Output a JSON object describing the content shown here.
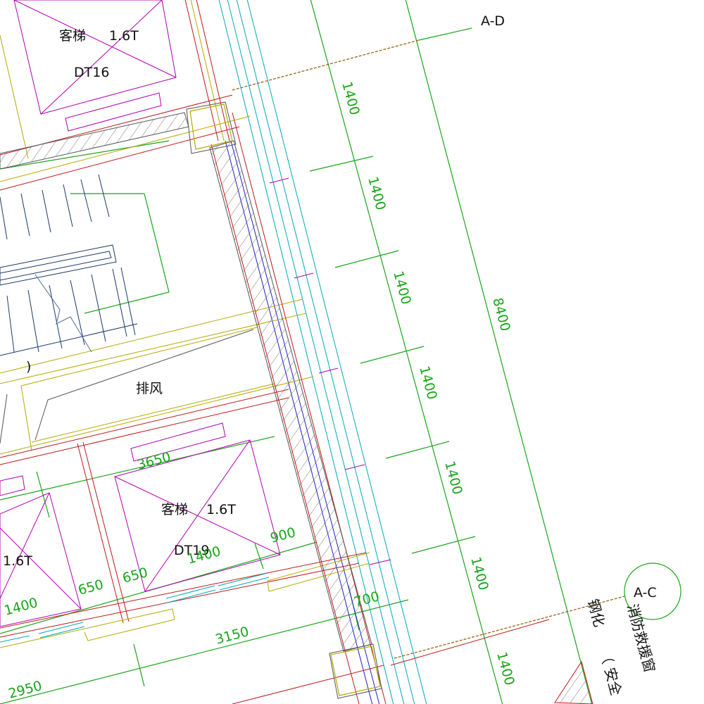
{
  "colors": {
    "background": "#ffffff",
    "dimension": "#1aa51a",
    "magenta": "#b000b0",
    "red": "#c01818",
    "yellow": "#b8a800",
    "cyan": "#00a8c0",
    "blue": "#2020c0",
    "gray": "#555555",
    "navy": "#1a3a6a",
    "brown": "#8a5a00",
    "text": "#111111"
  },
  "axes": {
    "ad": "A-D",
    "ac": "A-C"
  },
  "elevators": {
    "top": {
      "type": "客梯",
      "load": "1.6T",
      "code": "DT16"
    },
    "middle": {
      "type": "客梯",
      "load": "1.6T",
      "code": "DT19"
    },
    "left_load": "1.6T"
  },
  "rooms": {
    "exhaust": "排风",
    "paren": ")"
  },
  "notes": {
    "fire_rescue_window": "消防救援窗",
    "tempered": "钢化",
    "safety": "（ 安全"
  },
  "dimensions": {
    "right_chain": [
      "1400",
      "1400",
      "1400",
      "1400",
      "1400",
      "1400",
      "1400"
    ],
    "overall": "8400",
    "bottom": [
      "2950",
      "3150"
    ],
    "lower_left": [
      "1400",
      "650",
      "650",
      "1400"
    ],
    "small": [
      "3650",
      "900",
      "700"
    ]
  }
}
